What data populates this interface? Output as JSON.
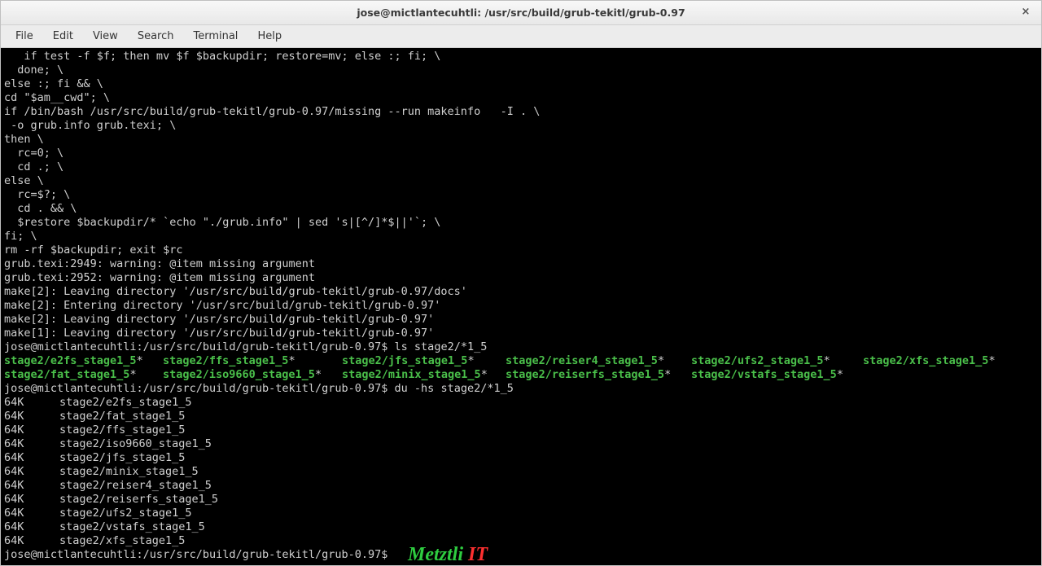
{
  "window": {
    "title": "jose@mictlantecuhtli: /usr/src/build/grub-tekitl/grub-0.97",
    "close": "×"
  },
  "menu": {
    "file": "File",
    "edit": "Edit",
    "view": "View",
    "search": "Search",
    "terminal": "Terminal",
    "help": "Help"
  },
  "output": {
    "pre1": "   if test -f $f; then mv $f $backupdir; restore=mv; else :; fi; \\\n  done; \\\nelse :; fi && \\\ncd \"$am__cwd\"; \\\nif /bin/bash /usr/src/build/grub-tekitl/grub-0.97/missing --run makeinfo   -I . \\\n -o grub.info grub.texi; \\\nthen \\\n  rc=0; \\\n  cd .; \\\nelse \\\n  rc=$?; \\\n  cd . && \\\n  $restore $backupdir/* `echo \"./grub.info\" | sed 's|[^/]*$||'`; \\\nfi; \\\nrm -rf $backupdir; exit $rc\ngrub.texi:2949: warning: @item missing argument\ngrub.texi:2952: warning: @item missing argument\nmake[2]: Leaving directory '/usr/src/build/grub-tekitl/grub-0.97/docs'\nmake[2]: Entering directory '/usr/src/build/grub-tekitl/grub-0.97'\nmake[2]: Leaving directory '/usr/src/build/grub-tekitl/grub-0.97'\nmake[1]: Leaving directory '/usr/src/build/grub-tekitl/grub-0.97'",
    "prompt": "jose@mictlantecuhtli:/usr/src/build/grub-tekitl/grub-0.97$ ",
    "cmd_ls": "ls stage2/*1_5",
    "cmd_du": "du -hs stage2/*1_5",
    "cmd_empty": ""
  },
  "ls": {
    "row1": [
      "stage2/e2fs_stage1_5",
      "stage2/ffs_stage1_5",
      "stage2/jfs_stage1_5",
      "stage2/reiser4_stage1_5",
      "stage2/ufs2_stage1_5",
      "stage2/xfs_stage1_5"
    ],
    "row2": [
      "stage2/fat_stage1_5",
      "stage2/iso9660_stage1_5",
      "stage2/minix_stage1_5",
      "stage2/reiserfs_stage1_5",
      "stage2/vstafs_stage1_5"
    ]
  },
  "du": [
    {
      "size": "64K",
      "file": "stage2/e2fs_stage1_5"
    },
    {
      "size": "64K",
      "file": "stage2/fat_stage1_5"
    },
    {
      "size": "64K",
      "file": "stage2/ffs_stage1_5"
    },
    {
      "size": "64K",
      "file": "stage2/iso9660_stage1_5"
    },
    {
      "size": "64K",
      "file": "stage2/jfs_stage1_5"
    },
    {
      "size": "64K",
      "file": "stage2/minix_stage1_5"
    },
    {
      "size": "64K",
      "file": "stage2/reiser4_stage1_5"
    },
    {
      "size": "64K",
      "file": "stage2/reiserfs_stage1_5"
    },
    {
      "size": "64K",
      "file": "stage2/ufs2_stage1_5"
    },
    {
      "size": "64K",
      "file": "stage2/vstafs_stage1_5"
    },
    {
      "size": "64K",
      "file": "stage2/xfs_stage1_5"
    }
  ],
  "watermark": {
    "t1": "Metztli ",
    "t2": "IT"
  }
}
